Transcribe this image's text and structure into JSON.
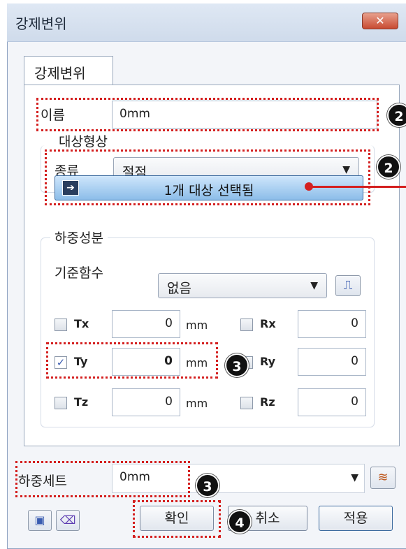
{
  "window": {
    "title": "강제변위",
    "close_label": "✕"
  },
  "tab": {
    "label": "강제변위"
  },
  "name": {
    "label": "이름",
    "value": "0mm"
  },
  "target": {
    "group_title": "대상형상",
    "type_label": "종류",
    "type_value": "절점",
    "select_button_label": "1개 대상 선택됨"
  },
  "load": {
    "group_title": "하중성분",
    "ref_function_label": "기준함수",
    "ref_function_value": "없음",
    "rows": [
      {
        "t_label": "Tx",
        "t_value": "0",
        "t_unit": "mm",
        "t_checked": false,
        "r_label": "Rx",
        "r_value": "0",
        "r_checked": false
      },
      {
        "t_label": "Ty",
        "t_value": "0",
        "t_unit": "mm",
        "t_checked": true,
        "r_label": "Ry",
        "r_value": "0",
        "r_checked": false
      },
      {
        "t_label": "Tz",
        "t_value": "0",
        "t_unit": "mm",
        "t_checked": false,
        "r_label": "Rz",
        "r_value": "0",
        "r_checked": false
      }
    ]
  },
  "load_set": {
    "label": "하중세트",
    "value": "0mm"
  },
  "buttons": {
    "ok": "확인",
    "cancel": "취소",
    "apply": "적용"
  },
  "annotations": {
    "badge_name": "2",
    "badge_target": "2",
    "badge_ty": "3",
    "badge_loadset": "3",
    "badge_ok": "4"
  },
  "colors": {
    "annotation_red": "#d42020",
    "select_button_blue": "#8cbde9",
    "close_red": "#c84a32"
  }
}
